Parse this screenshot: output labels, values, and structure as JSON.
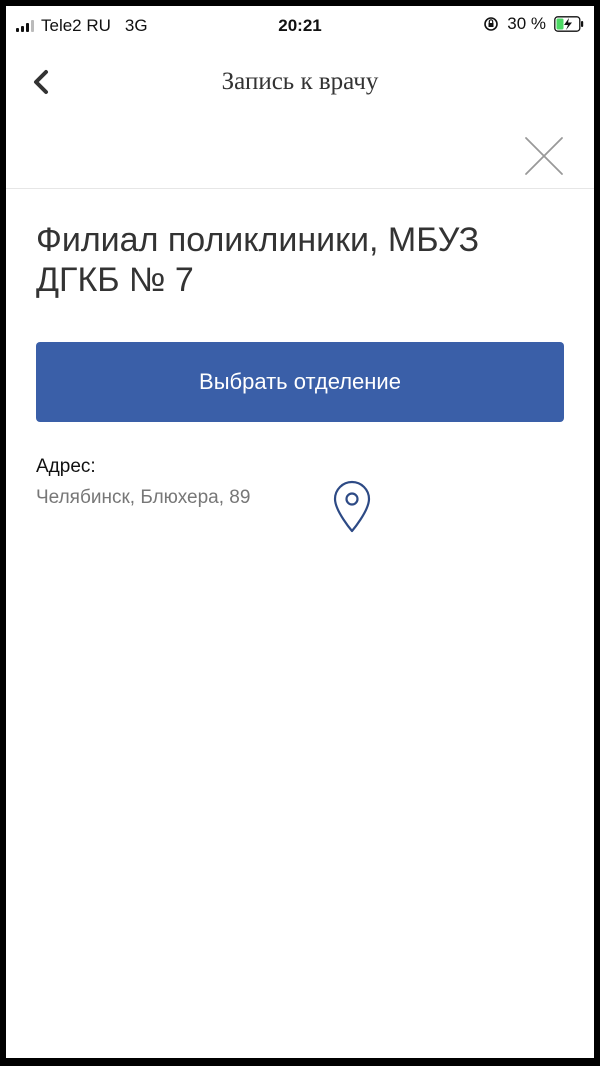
{
  "status_bar": {
    "carrier": "Tele2 RU",
    "network": "3G",
    "time": "20:21",
    "battery": "30 %",
    "icons": [
      "signal-bars",
      "orientation-lock",
      "battery-charging"
    ]
  },
  "nav": {
    "back_icon": "chevron-left",
    "title": "Запись к врачу"
  },
  "close_icon": "close-x",
  "clinic": {
    "name": "Филиал поликлиники, МБУЗ ДГКБ № 7"
  },
  "select_department_button": "Выбрать отделение",
  "address": {
    "label": "Адрес:",
    "value": "Челябинск, Блюхера, 89",
    "icon": "map-pin"
  },
  "colors": {
    "primary": "#3a5fa8",
    "icon": "#2d4a85",
    "text": "#333333",
    "muted": "#777777"
  }
}
